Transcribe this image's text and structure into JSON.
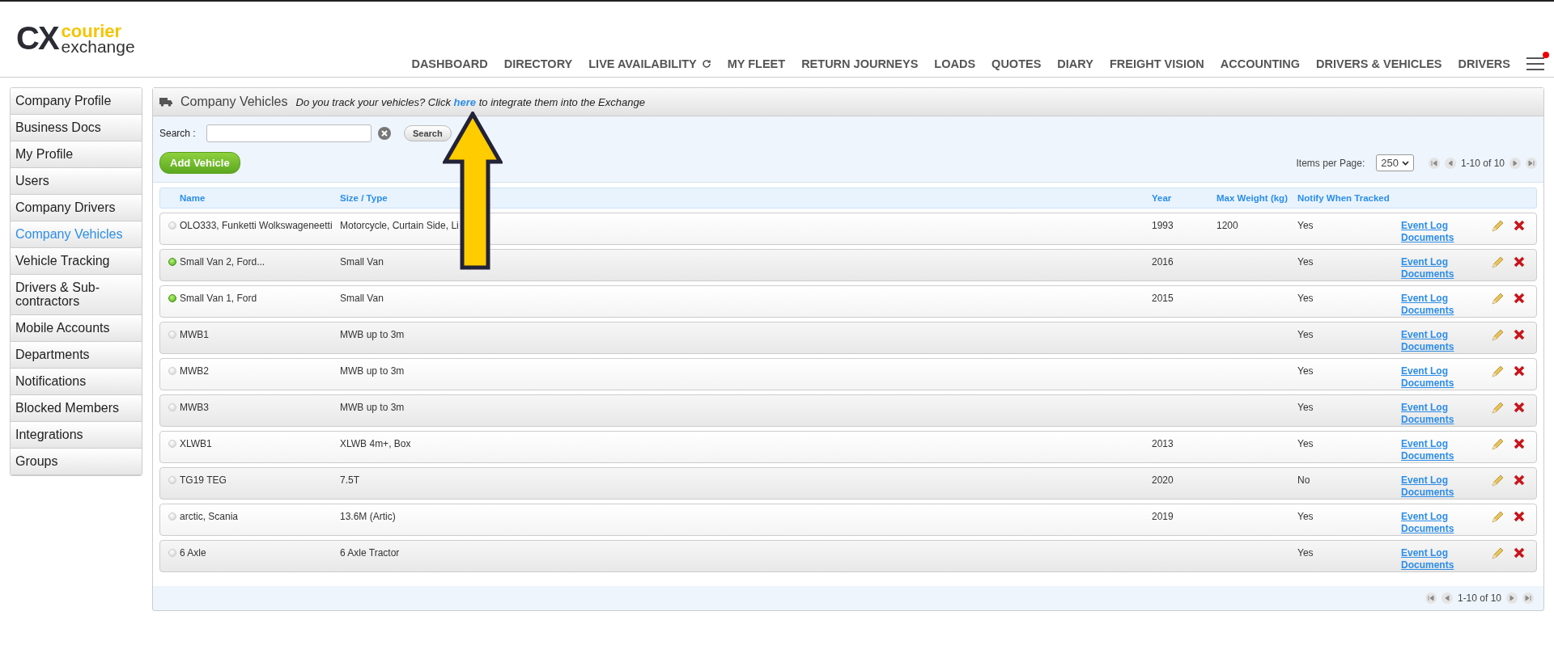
{
  "logo": {
    "mark": "CX",
    "line1": "courier",
    "line2": "exchange"
  },
  "nav": [
    {
      "label": "DASHBOARD",
      "kind": "plain"
    },
    {
      "label": "DIRECTORY",
      "kind": "plain"
    },
    {
      "label": "LIVE AVAILABILITY",
      "kind": "refresh"
    },
    {
      "label": "MY FLEET",
      "kind": "plain"
    },
    {
      "label": "RETURN JOURNEYS",
      "kind": "plain"
    },
    {
      "label": "LOADS",
      "kind": "plain"
    },
    {
      "label": "QUOTES",
      "kind": "plain"
    },
    {
      "label": "DIARY",
      "kind": "plain"
    },
    {
      "label": "FREIGHT VISION",
      "kind": "plain"
    },
    {
      "label": "ACCOUNTING",
      "kind": "plain"
    },
    {
      "label": "DRIVERS & VEHICLES",
      "kind": "plain"
    },
    {
      "label": "DRIVERS",
      "kind": "plain"
    }
  ],
  "menu": {
    "notification": true
  },
  "sidebar": {
    "items": [
      {
        "label": "Company Profile",
        "selected": false
      },
      {
        "label": "Business Docs",
        "selected": false
      },
      {
        "label": "My Profile",
        "selected": false
      },
      {
        "label": "Users",
        "selected": false
      },
      {
        "label": "Company Drivers",
        "selected": false
      },
      {
        "label": "Company Vehicles",
        "selected": true
      },
      {
        "label": "Vehicle Tracking",
        "selected": false
      },
      {
        "label": "Drivers & Sub-contractors",
        "selected": false
      },
      {
        "label": "Mobile Accounts",
        "selected": false
      },
      {
        "label": "Departments",
        "selected": false
      },
      {
        "label": "Notifications",
        "selected": false
      },
      {
        "label": "Blocked Members",
        "selected": false
      },
      {
        "label": "Integrations",
        "selected": false
      },
      {
        "label": "Groups",
        "selected": false
      }
    ]
  },
  "panel": {
    "title": "Company Vehicles",
    "notice": "*Do you track your vehicles? Click* ",
    "notice_link": "here",
    "notice_end": " to integrate them into the Exchange"
  },
  "search": {
    "label": "Search :",
    "button": "Search"
  },
  "add_button": "Add Vehicle",
  "pagination_top": {
    "label": "Items per Page:",
    "per_page": "250",
    "range": "1-10 of 10"
  },
  "table": {
    "columns": [
      "Name",
      "Size / Type",
      "Year",
      "Max Weight (kg)",
      "Notify When Tracked"
    ],
    "rows": [
      {
        "tracking": false,
        "name": "OLO333, Funketti Wolkswageneetti",
        "type": "Motorcycle, Curtain Side, Li",
        "year": "1993",
        "weight": "1200",
        "notify": "Yes",
        "link1": "Event Log",
        "link2": "Documents"
      },
      {
        "tracking": true,
        "name": "Small Van 2, Ford...",
        "type": "Small Van",
        "year": "2016",
        "notify": "Yes",
        "link1": "Event Log",
        "link2": "Documents"
      },
      {
        "tracking": true,
        "name": "Small Van 1, Ford",
        "type": "Small Van",
        "year": "2015",
        "notify": "Yes",
        "link1": "Event Log",
        "link2": "Documents"
      },
      {
        "tracking": false,
        "name": "MWB1",
        "type": "MWB up to 3m",
        "notify": "Yes",
        "link1": "Event Log",
        "link2": "Documents"
      },
      {
        "tracking": false,
        "name": "MWB2",
        "type": "MWB up to 3m",
        "notify": "Yes",
        "link1": "Event Log",
        "link2": "Documents"
      },
      {
        "tracking": false,
        "name": "MWB3",
        "type": "MWB up to 3m",
        "notify": "Yes",
        "link1": "Event Log",
        "link2": "Documents"
      },
      {
        "tracking": false,
        "name": "XLWB1",
        "type": "XLWB 4m+, Box",
        "year": "2013",
        "notify": "Yes",
        "link1": "Event Log",
        "link2": "Documents"
      },
      {
        "tracking": false,
        "name": "TG19 TEG",
        "type": "7.5T",
        "year": "2020",
        "notify": "No",
        "link1": "Event Log",
        "link2": "Documents"
      },
      {
        "tracking": false,
        "name": "arctic, Scania",
        "type": "13.6M (Artic)",
        "year": "2019",
        "notify": "Yes",
        "link1": "Event Log",
        "link2": "Documents"
      },
      {
        "tracking": false,
        "name": "6 Axle",
        "type": "6 Axle Tractor",
        "notify": "Yes",
        "link1": "Event Log",
        "link2": "Documents"
      }
    ]
  },
  "pagination_bottom": {
    "range": "1-10 of 10"
  }
}
